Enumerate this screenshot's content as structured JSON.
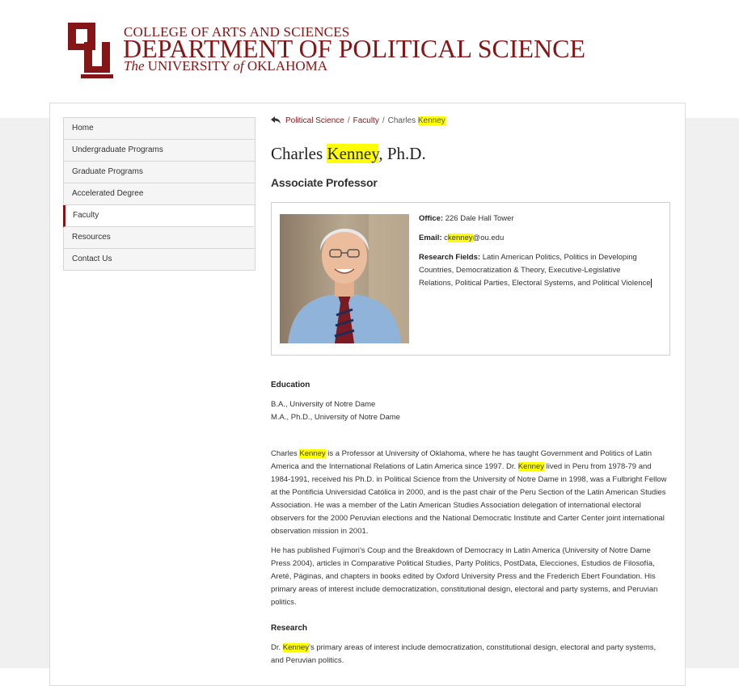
{
  "header": {
    "college": "COLLEGE OF ARTS AND SCIENCES",
    "department": "DEPARTMENT OF POLITICAL SCIENCE",
    "university_the": "The",
    "university_a": "UNIVERSITY",
    "university_of": "of",
    "university_b": "OKLAHOMA",
    "brand_color": "#841617"
  },
  "sidebar": {
    "items": [
      {
        "label": "Home"
      },
      {
        "label": "Undergraduate Programs"
      },
      {
        "label": "Graduate Programs"
      },
      {
        "label": "Accelerated Degree"
      },
      {
        "label": "Faculty",
        "active": true
      },
      {
        "label": "Resources"
      },
      {
        "label": "Contact Us"
      }
    ]
  },
  "breadcrumb": {
    "items": [
      "Political Science",
      "Faculty"
    ],
    "current_first": "Charles",
    "current_highlight": "Kenney"
  },
  "profile": {
    "name_first": "Charles",
    "name_highlight": "Kenney",
    "name_suffix": ", Ph.D.",
    "position": "Associate Professor",
    "office_label": "Office:",
    "office_value": "226 Dale Hall Tower",
    "email_label": "Email:",
    "email_prefix": "c",
    "email_highlight": "kenney",
    "email_suffix": "@ou.edu",
    "research_label": "Research Fields:",
    "research_value": "Latin American Politics, Politics in Developing Countries, Democratization & Theory, Executive-Legislative Relations, Political Parties, Electoral Systems, and Political Violence"
  },
  "education": {
    "heading": "Education",
    "lines": [
      "B.A., University of Notre Dame",
      "M.A., Ph.D., University of Notre Dame"
    ]
  },
  "bio": {
    "p1_a": "Charles ",
    "p1_hl1": "Kenney",
    "p1_b": " is a Professor at University of Oklahoma, where he has taught Government and Politics of Latin America and the International Relations of Latin America since 1997. Dr. ",
    "p1_hl2": "Kenney",
    "p1_c": " lived in Peru from 1978-79 and 1984-1991, received his Ph.D. in Political Science from the University of Notre Dame in 1998, was a Fulbright Fellow at the Pontificia Universidad Católica in 2000, and is the past chair of the Peru Section of the Latin American Studies Association. He was a member of the Latin American Studies Association delegation of international electoral observers for the 2000 Peruvian elections and the National Democratic Institute and Carter Center joint international observation mission in 2001.",
    "p2": "He has published Fujimori’s Coup and the Breakdown of Democracy in Latin America (University of Notre Dame Press 2004), articles in Comparative Political Studies, Party Politics, PostData, Elecciones, Estudios de Filosofía, Areté, Páginas, and chapters in books edited by Oxford University Press and the Frederich Ebert Foundation. His primary areas of interest include democratization, constitutional design, electoral and party systems, and Peruvian politics."
  },
  "research": {
    "heading": "Research",
    "text_a": "Dr. ",
    "text_hl": "Kenney",
    "text_b": "’s primary areas of interest include democratization, constitutional design, electoral and party systems, and Peruvian politics."
  },
  "colors": {
    "highlight": "#ffff00",
    "link": "#841617"
  }
}
